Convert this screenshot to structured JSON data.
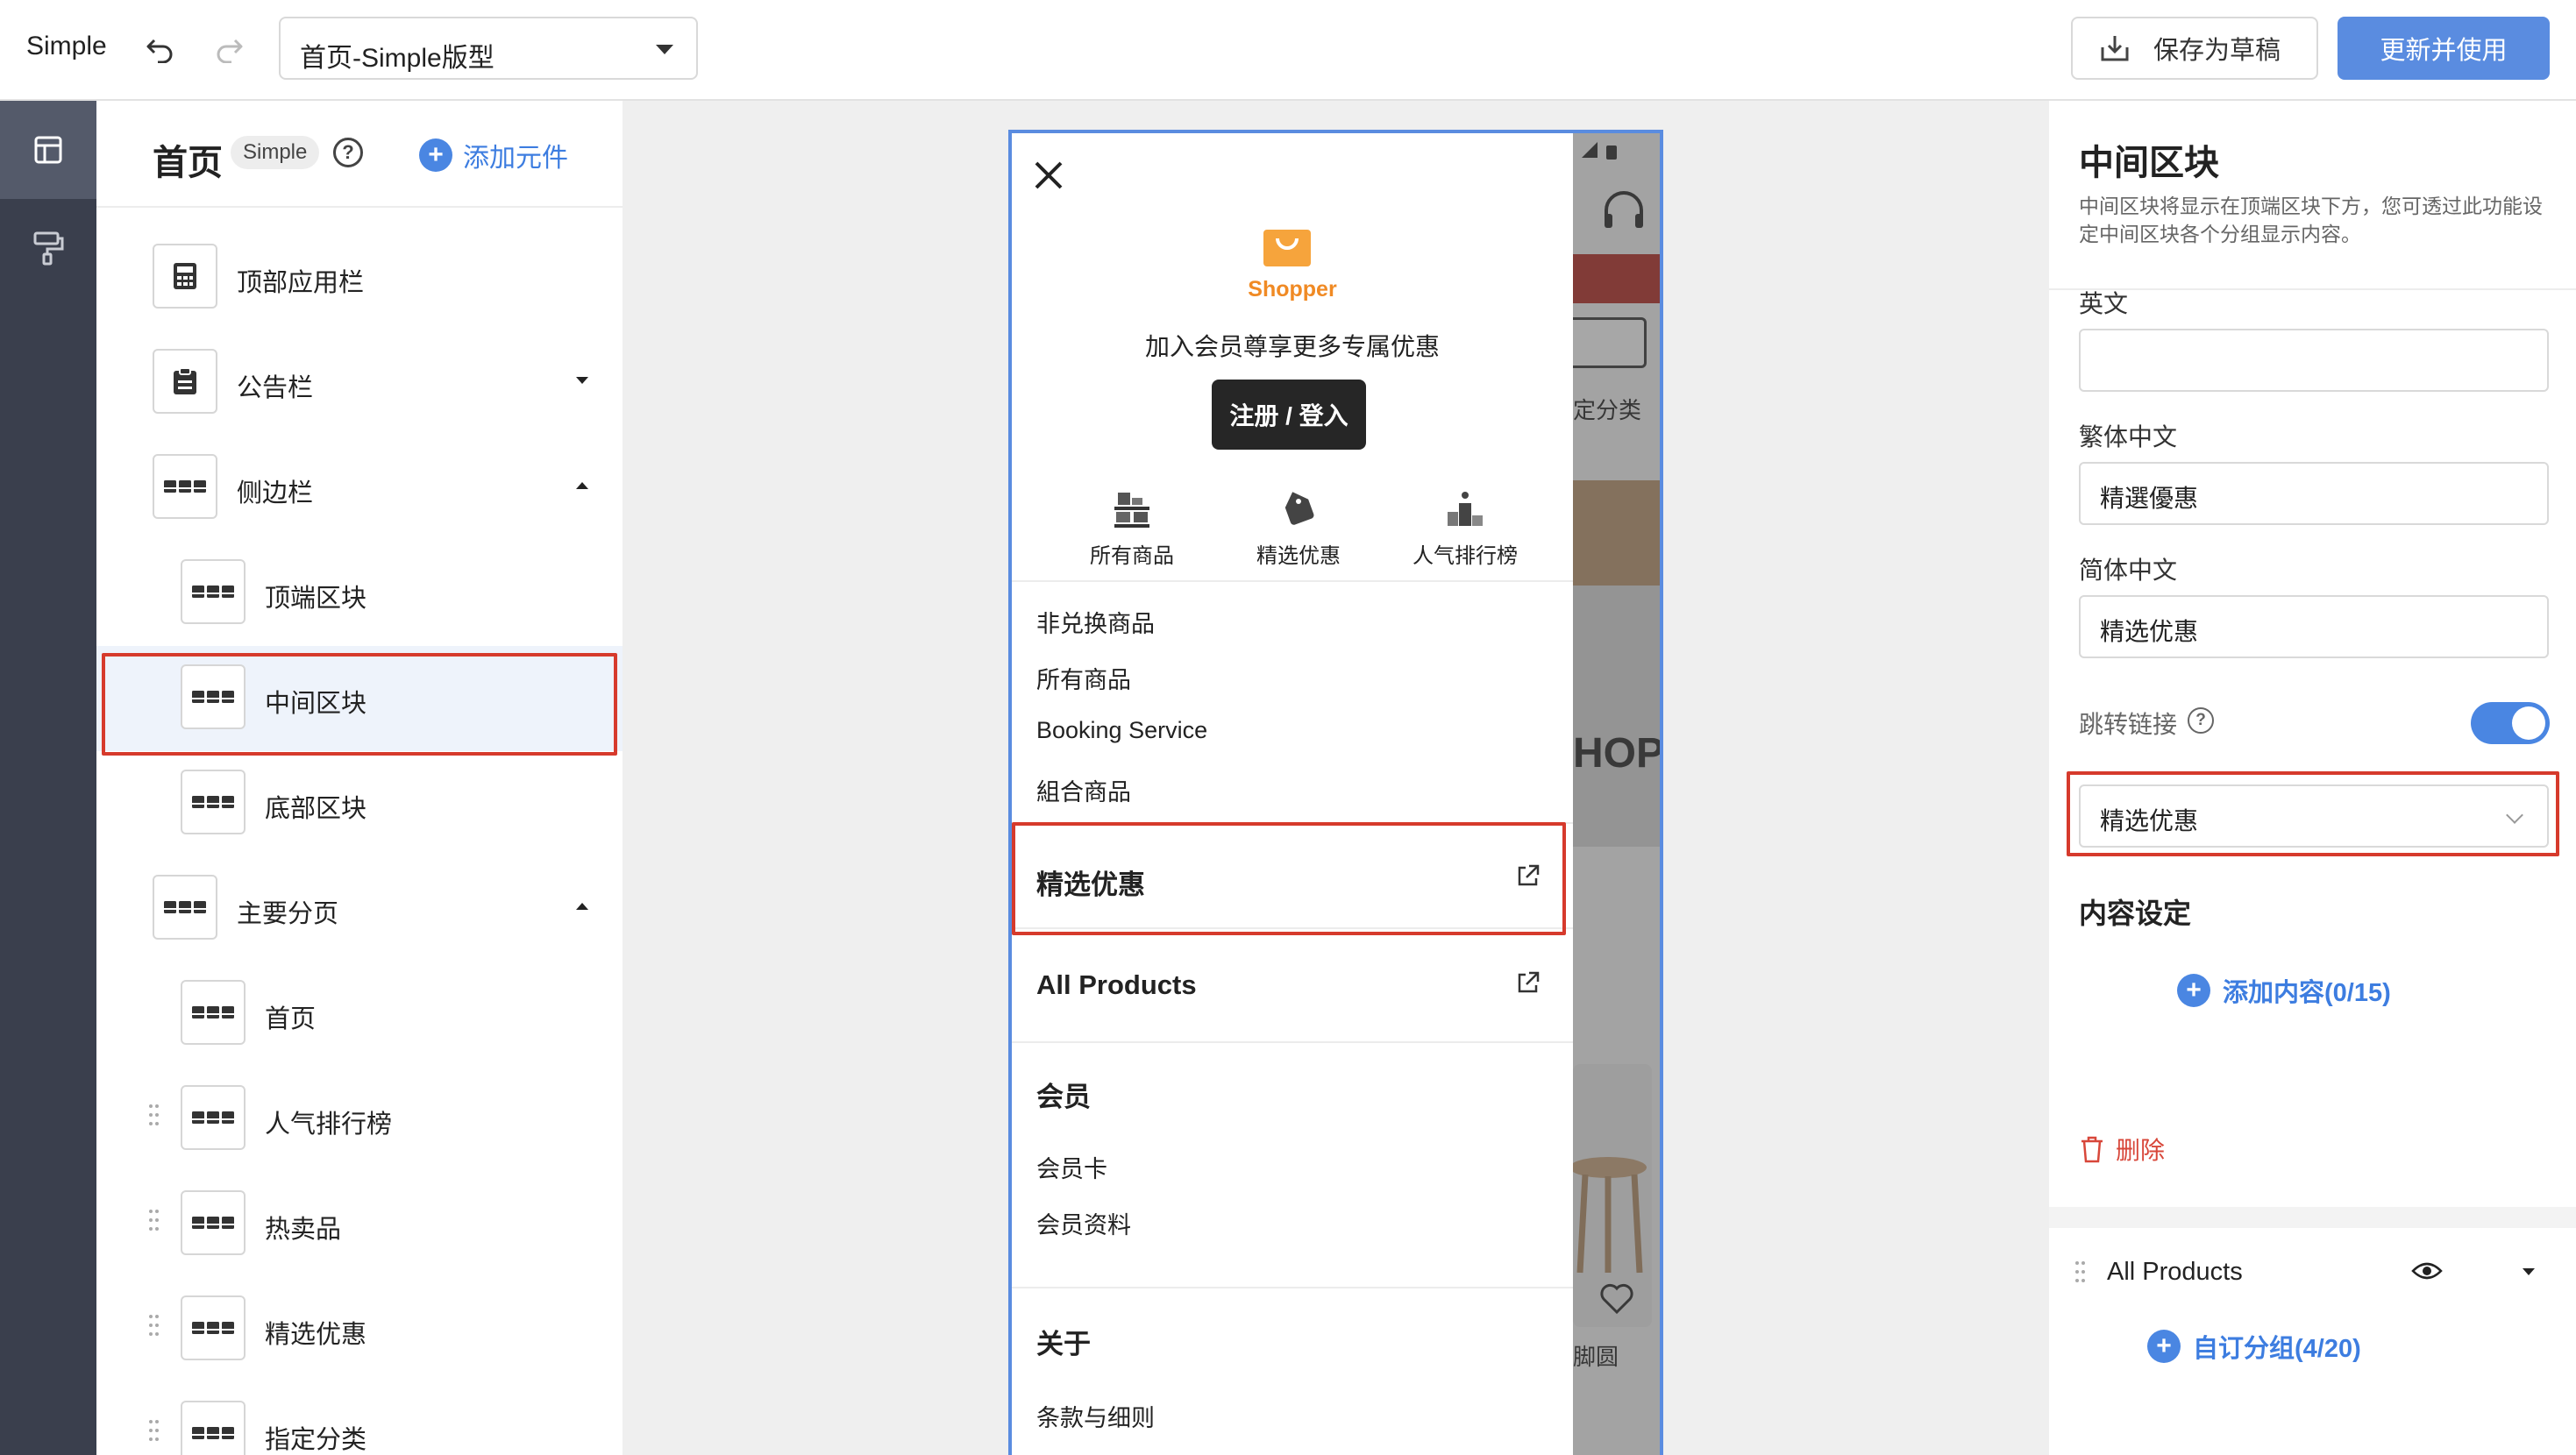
{
  "topbar": {
    "app_name": "Simple",
    "page_select": "首页-Simple版型",
    "save_draft": "保存为草稿",
    "update_use": "更新并使用"
  },
  "panel": {
    "title": "首页",
    "badge": "Simple",
    "help": "?",
    "add_element": "添加元件",
    "tree": [
      {
        "label": "顶部应用栏"
      },
      {
        "label": "公告栏"
      },
      {
        "label": "侧边栏"
      },
      {
        "label": "顶端区块"
      },
      {
        "label": "中间区块"
      },
      {
        "label": "底部区块"
      },
      {
        "label": "主要分页"
      },
      {
        "label": "首页"
      },
      {
        "label": "人气排行榜"
      },
      {
        "label": "热卖品"
      },
      {
        "label": "精选优惠"
      },
      {
        "label": "指定分类"
      }
    ]
  },
  "preview": {
    "shop_name": "Shopper",
    "join_text": "加入会员尊享更多专属优惠",
    "login": "注册 / 登入",
    "quick_links": [
      {
        "label": "所有商品"
      },
      {
        "label": "精选优惠"
      },
      {
        "label": "人气排行榜"
      }
    ],
    "links": [
      "非兑换商品",
      "所有商品",
      "Booking Service",
      "組合商品"
    ],
    "featured": "精选优惠",
    "all_products": "All Products",
    "member_section": "会员",
    "member_links": [
      "会员卡",
      "会员资料"
    ],
    "about_section": "关于",
    "about_links": [
      "条款与细则"
    ],
    "backdrop_text_1": "定分类",
    "backdrop_text_2": "HOP",
    "backdrop_text_3": "脚圆"
  },
  "settings": {
    "title": "中间区块",
    "description": "中间区块将显示在顶端区块下方，您可透过此功能设定中间区块各个分组显示内容。",
    "english_label": "英文",
    "english_value": "",
    "trad_label": "繁体中文",
    "trad_value": "精選優惠",
    "simp_label": "简体中文",
    "simp_value": "精选优惠",
    "link_label": "跳转链接",
    "link_help": "?",
    "link_enabled": true,
    "link_value": "精选优惠",
    "content_title": "内容设定",
    "add_content": "添加内容(0/15)",
    "delete": "删除",
    "group_name": "All Products",
    "custom_group": "自订分组(4/20)"
  },
  "colors": {
    "primary": "#5a8ce0",
    "link_blue": "#3d7de0",
    "highlight_red": "#d63a2c",
    "rail": "#3a3f4d",
    "brand_orange": "#f08a24"
  }
}
